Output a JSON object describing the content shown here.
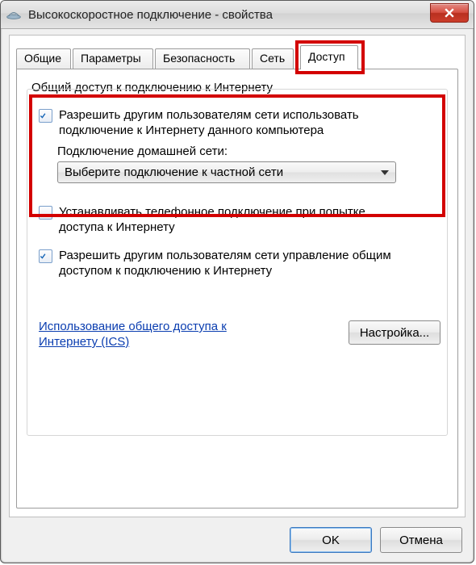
{
  "window": {
    "title": "Высокоскоростное подключение - свойства",
    "close_name": "close"
  },
  "tabs": {
    "t0": "Общие",
    "t1": "Параметры",
    "t2": "Безопасность",
    "t3": "Сеть",
    "t4": "Доступ"
  },
  "group": {
    "title": "Общий доступ к подключению к Интернету"
  },
  "opt1": {
    "label": "Разрешить другим пользователям сети использовать подключение к Интернету данного компьютера",
    "checked": true,
    "sublabel": "Подключение домашней сети:",
    "select_value": "Выберите подключение к частной сети"
  },
  "opt2": {
    "label": "Устанавливать телефонное подключение при попытке доступа к Интернету",
    "checked": false
  },
  "opt3": {
    "label": "Разрешить другим пользователям сети управление общим доступом к подключению к Интернету",
    "checked": true
  },
  "link": {
    "text": "Использование общего доступа к Интернету (ICS)"
  },
  "buttons": {
    "settings": "Настройка...",
    "ok": "OK",
    "cancel": "Отмена"
  }
}
